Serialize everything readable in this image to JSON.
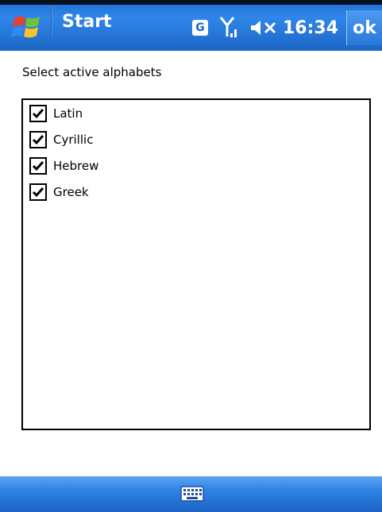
{
  "titlebar": {
    "start_label": "Start",
    "tray": {
      "g_label": "G",
      "time": "16:34",
      "ok_label": "ok"
    }
  },
  "dialog": {
    "instruction": "Select active alphabets",
    "items": [
      {
        "label": "Latin",
        "checked": true
      },
      {
        "label": "Cyrillic",
        "checked": true
      },
      {
        "label": "Hebrew",
        "checked": true
      },
      {
        "label": "Greek",
        "checked": true
      }
    ]
  },
  "colors": {
    "title_bar": "#1d6fd6",
    "bottom_bar": "#2d83e2"
  },
  "icons": {
    "start": "windows-flag-icon",
    "signal": "signal-icon",
    "speaker": "speaker-muted-icon",
    "keyboard": "keyboard-icon"
  }
}
